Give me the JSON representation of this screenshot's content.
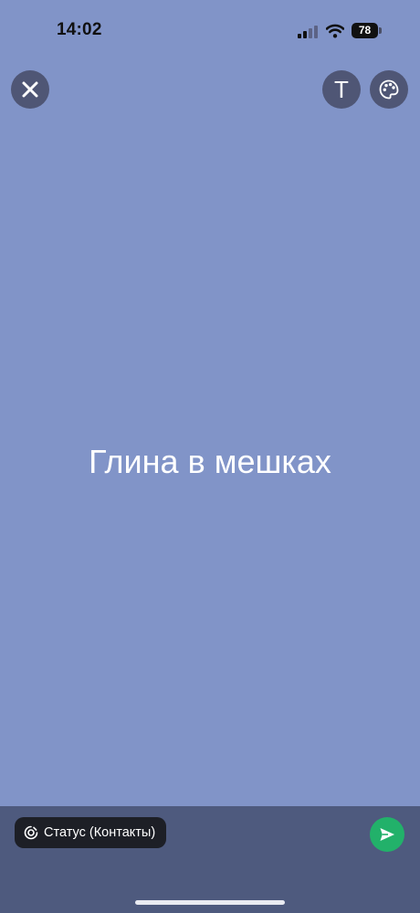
{
  "status_bar": {
    "time": "14:02",
    "battery": "78",
    "signal_icon": "signal-icon",
    "wifi_icon": "wifi-icon",
    "battery_icon": "battery-icon"
  },
  "toolbar": {
    "close_icon": "close-icon",
    "text_button_label": "T",
    "palette_icon": "palette-icon"
  },
  "status_text": "Глина в мешках",
  "composer": {
    "audience_label": "Статус (Контакты)",
    "status_icon": "status-ring-icon",
    "send_icon": "send-icon"
  },
  "colors": {
    "background": "#8194c8",
    "bottom_bar": "#4e5a7e",
    "send_button": "#22b16a",
    "control_circle": "#4f5675"
  }
}
